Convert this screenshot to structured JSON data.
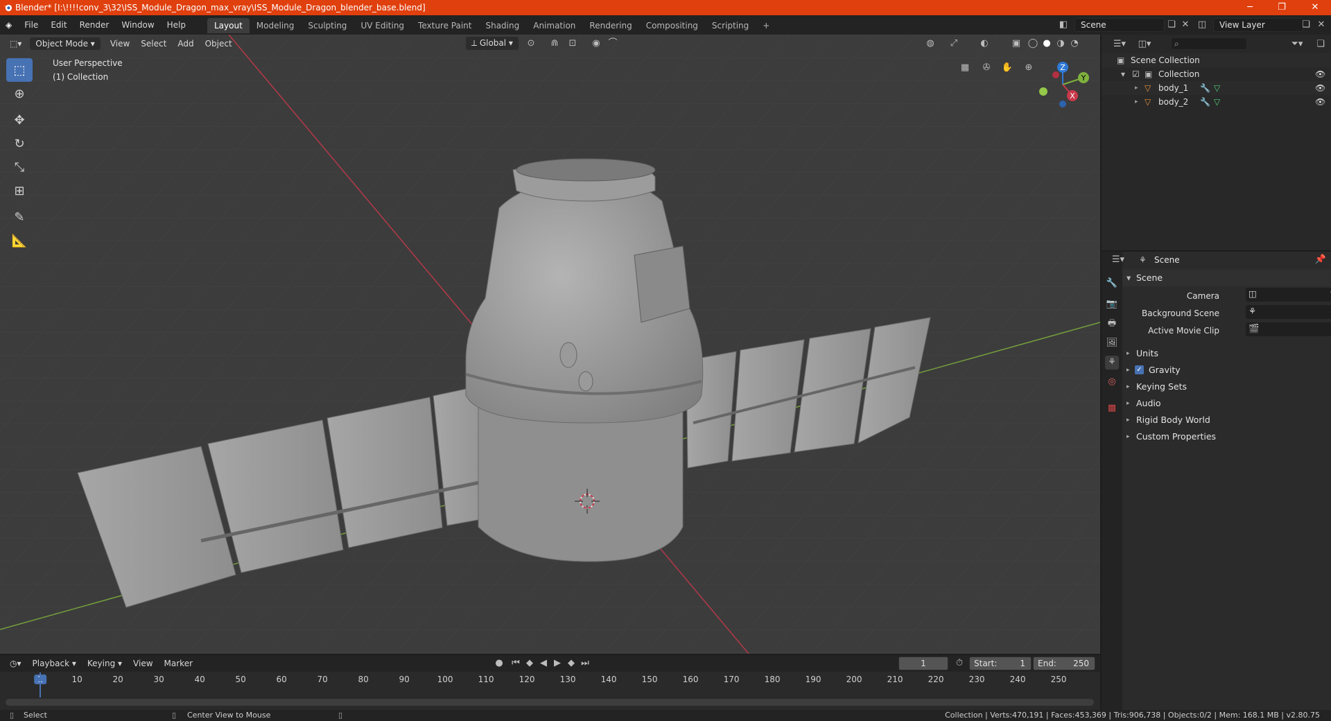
{
  "window": {
    "title": "Blender* [I:\\!!!!conv_3\\32\\ISS_Module_Dragon_max_vray\\ISS_Module_Dragon_blender_base.blend]",
    "minimize": "─",
    "maximize": "❐",
    "close": "✕"
  },
  "menu": [
    "File",
    "Edit",
    "Render",
    "Window",
    "Help"
  ],
  "workspaces": [
    "Layout",
    "Modeling",
    "Sculpting",
    "UV Editing",
    "Texture Paint",
    "Shading",
    "Animation",
    "Rendering",
    "Compositing",
    "Scripting"
  ],
  "workspace_add": "+",
  "scene_field": "Scene",
  "view_layer_field": "View Layer",
  "viewport": {
    "mode": "Object Mode",
    "menus": [
      "View",
      "Select",
      "Add",
      "Object"
    ],
    "transform": "Global",
    "overlay_line1": "User Perspective",
    "overlay_line2": "(1) Collection",
    "gizmo": {
      "x": "X",
      "y": "Y",
      "z": "Z"
    }
  },
  "outliner": {
    "root": "Scene Collection",
    "collection": "Collection",
    "items": [
      "body_1",
      "body_2"
    ]
  },
  "properties": {
    "context": "Scene",
    "section": "Scene",
    "fields": [
      {
        "label": "Camera"
      },
      {
        "label": "Background Scene"
      },
      {
        "label": "Active Movie Clip"
      }
    ],
    "panels": [
      "Units",
      "Gravity",
      "Keying Sets",
      "Audio",
      "Rigid Body World",
      "Custom Properties"
    ]
  },
  "timeline": {
    "menus": [
      "Playback",
      "Keying",
      "View",
      "Marker"
    ],
    "current_frame": "1",
    "start_label": "Start:",
    "start": "1",
    "end_label": "End:",
    "end": "250",
    "ticks": [
      "1",
      "10",
      "20",
      "30",
      "40",
      "50",
      "60",
      "70",
      "80",
      "90",
      "100",
      "110",
      "120",
      "130",
      "140",
      "150",
      "160",
      "170",
      "180",
      "190",
      "200",
      "210",
      "220",
      "230",
      "240",
      "250"
    ]
  },
  "status": {
    "left": "Select",
    "middle": "Center View to Mouse",
    "right": "Collection | Verts:470,191 | Faces:453,369 | Tris:906,738 | Objects:0/2 | Mem: 168.1 MB | v2.80.75"
  },
  "colors": {
    "titlebar": "#e0400e",
    "accent": "#4772b3",
    "viewport_bg": "#3c3c3c",
    "x_axis": "#c9394b",
    "y_axis": "#7fb13d",
    "z_axis": "#2f79d6"
  }
}
